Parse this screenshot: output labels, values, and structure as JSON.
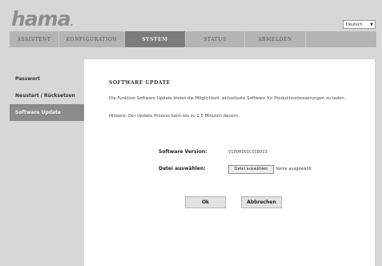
{
  "brand": {
    "name": "hama",
    "suffix": "."
  },
  "language": {
    "selected": "Deutsch",
    "arrow": "▼"
  },
  "nav": {
    "tabs": [
      {
        "label": "ASSISTENT"
      },
      {
        "label": "KONFIGURATION"
      },
      {
        "label": "SYSTEM"
      },
      {
        "label": "STATUS"
      },
      {
        "label": "ABMELDEN"
      }
    ],
    "active_index": 2
  },
  "sidebar": {
    "items": [
      {
        "label": "Passwort"
      },
      {
        "label": "Neustart / Rücksetzen"
      },
      {
        "label": "Software Update"
      }
    ],
    "active_index": 2
  },
  "main": {
    "title": "SOFTWARE UPDATE",
    "description": "Die Funktion Software Update bietet die Möglichkeit, aktuelleste Software für Produktverbesserungen zu laden.",
    "hint": "Hinweis: Der Update Prozess kann bis zu 2.5 Minuten dauern.",
    "version_label": "Software Version:",
    "version_value": "V100R001C01B013",
    "file_label": "Datei auswählen:",
    "file_button": "Datei auswählen",
    "file_status": "Keine ausgewählt",
    "ok_button": "Ok",
    "cancel_button": "Abbrechen"
  },
  "colors": {
    "nav_active": "#7c7c7c",
    "sidebar_active": "#8b8b8b",
    "background": "#d7d7d7"
  }
}
